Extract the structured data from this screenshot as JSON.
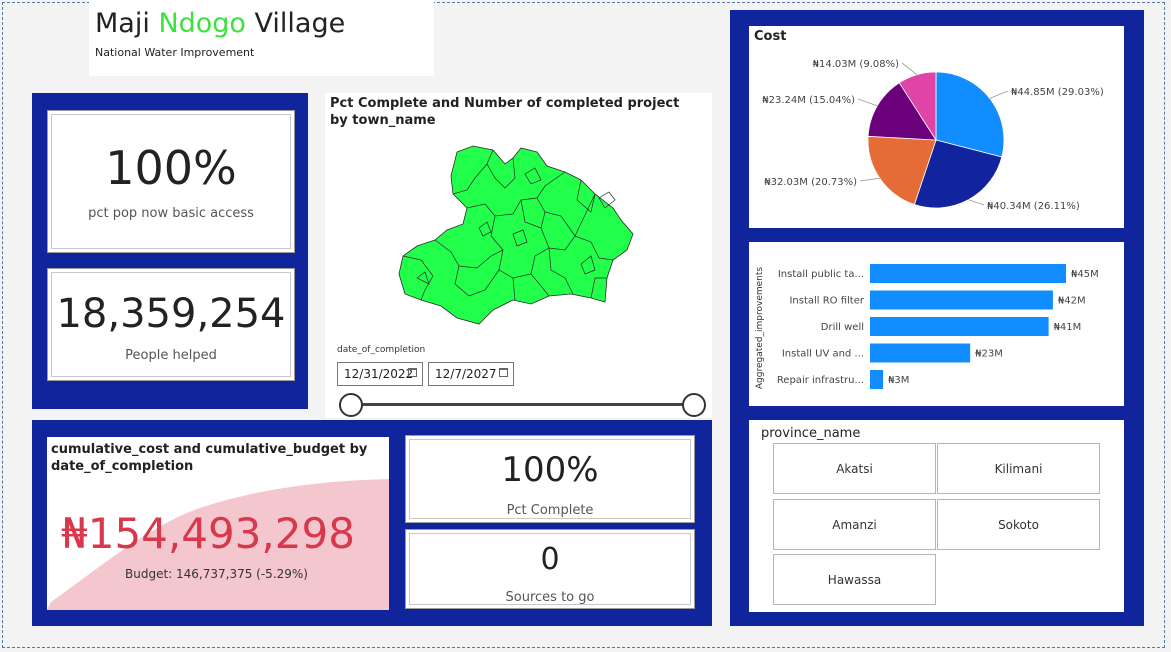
{
  "header": {
    "title_part1": "Maji ",
    "title_part2": "Ndogo",
    "title_part3": " Village",
    "subtitle": "National Water Improvement",
    "accent_color": "#3de33d"
  },
  "kpis": {
    "access": {
      "value": "100%",
      "label": "pct pop now basic access"
    },
    "people": {
      "value": "18,359,254",
      "label": "People helped"
    },
    "pct_complete": {
      "value": "100%",
      "label": "Pct Complete"
    },
    "sources": {
      "value": "0",
      "label": "Sources to go"
    }
  },
  "map": {
    "title": "Pct Complete and Number of completed project by town_name",
    "fill_color": "#22ff4a"
  },
  "date_slicer": {
    "label": "date_of_completion",
    "start": "12/31/2022",
    "end": "12/7/2027"
  },
  "cumulative": {
    "title": "cumulative_cost and cumulative_budget by date_of_completion",
    "value": "₦154,493,298",
    "budget_text": "Budget: 146,737,375 (-5.29%)",
    "value_color": "#d9384c"
  },
  "province_slicer": {
    "title": "province_name",
    "options": [
      "Akatsi",
      "Kilimani",
      "Amanzi",
      "Sokoto",
      "Hawassa"
    ]
  },
  "chart_data": [
    {
      "type": "pie",
      "title": "Cost",
      "slices": [
        {
          "value": 44.85,
          "label": "₦44.85M (29.03%)",
          "color": "#118dff"
        },
        {
          "value": 40.34,
          "label": "₦40.34M (26.11%)",
          "color": "#12239e"
        },
        {
          "value": 32.03,
          "label": "₦32.03M (20.73%)",
          "color": "#e66c37"
        },
        {
          "value": 23.24,
          "label": "₦23.24M (15.04%)",
          "color": "#6b007b"
        },
        {
          "value": 14.03,
          "label": "₦14.03M (9.08%)",
          "color": "#e044a7"
        }
      ]
    },
    {
      "type": "bar",
      "orientation": "horizontal",
      "ylabel": "Aggregated_improvements",
      "categories": [
        "Install public ta...",
        "Install RO filter",
        "Drill well",
        "Install UV and ...",
        "Repair infrastru..."
      ],
      "values": [
        45,
        42,
        41,
        23,
        3
      ],
      "labels": [
        "₦45M",
        "₦42M",
        "₦41M",
        "₦23M",
        "₦3M"
      ],
      "color": "#118dff",
      "xlim": [
        0,
        45
      ]
    }
  ]
}
